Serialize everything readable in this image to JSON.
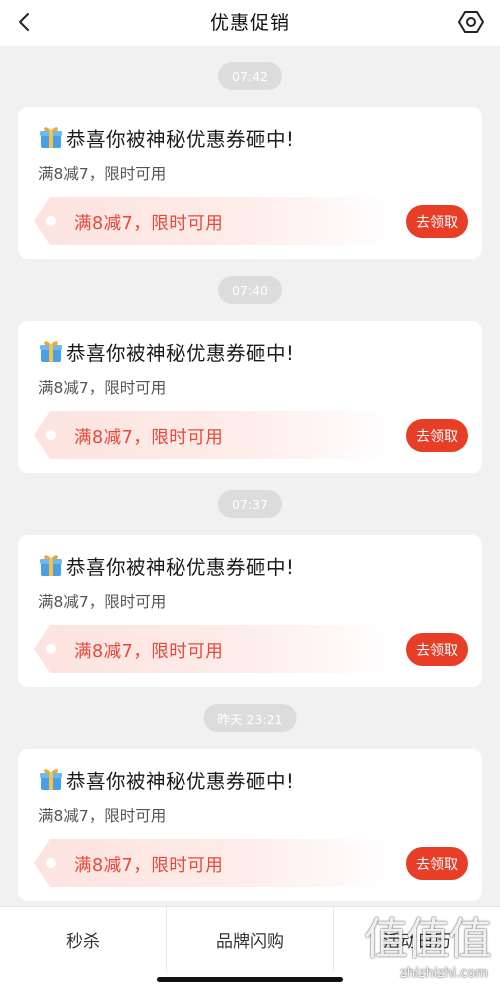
{
  "header": {
    "title": "优惠促销",
    "back_icon": "chevron-left-icon",
    "settings_icon": "hexagon-settings-icon"
  },
  "messages": [
    {
      "time": "07:42",
      "title": "恭喜你被神秘优惠券砸中!",
      "subtitle": "满8减7，限时可用",
      "coupon_text": "满8减7，限时可用",
      "button_label": "去领取"
    },
    {
      "time": "07:40",
      "title": "恭喜你被神秘优惠券砸中!",
      "subtitle": "满8减7，限时可用",
      "coupon_text": "满8减7，限时可用",
      "button_label": "去领取"
    },
    {
      "time": "07:37",
      "title": "恭喜你被神秘优惠券砸中!",
      "subtitle": "满8减7，限时可用",
      "coupon_text": "满8减7，限时可用",
      "button_label": "去领取"
    },
    {
      "time": "昨天 23:21",
      "title": "恭喜你被神秘优惠券砸中!",
      "subtitle": "满8减7，限时可用",
      "coupon_text": "满8减7，限时可用",
      "button_label": "去领取"
    }
  ],
  "tabs": [
    {
      "label": "秒杀"
    },
    {
      "label": "品牌闪购"
    },
    {
      "label": "活动日历"
    }
  ],
  "watermark": {
    "logo": "值值值",
    "url": "zhizhizhi.com"
  },
  "colors": {
    "accent": "#e83d27",
    "coupon_text": "#e8473a",
    "background": "#f1f1f1",
    "time_pill": "#dcdcdc"
  }
}
